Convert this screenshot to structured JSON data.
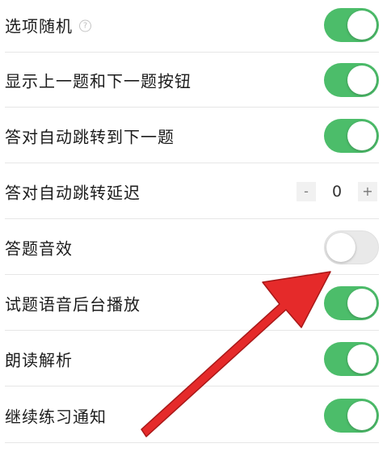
{
  "colors": {
    "toggle_on": "#4cbd6a",
    "toggle_off": "#e9e9e9",
    "arrow": "#e52a2a"
  },
  "settings": [
    {
      "label": "选项随机",
      "control": "toggle",
      "state": "on",
      "help_icon": "question-circle-icon",
      "help_glyph": "?"
    },
    {
      "label": "显示上一题和下一题按钮",
      "control": "toggle",
      "state": "on"
    },
    {
      "label": "答对自动跳转到下一题",
      "control": "toggle",
      "state": "on"
    },
    {
      "label": "答对自动跳转延迟",
      "control": "stepper",
      "value": "0",
      "minus_glyph": "-",
      "plus_glyph": "+"
    },
    {
      "label": "答题音效",
      "control": "toggle",
      "state": "off"
    },
    {
      "label": "试题语音后台播放",
      "control": "toggle",
      "state": "on"
    },
    {
      "label": "朗读解析",
      "control": "toggle",
      "state": "on"
    },
    {
      "label": "继续练习通知",
      "control": "toggle",
      "state": "on"
    }
  ],
  "annotation": {
    "icon": "red-arrow-icon",
    "points_to": "答题音效"
  }
}
